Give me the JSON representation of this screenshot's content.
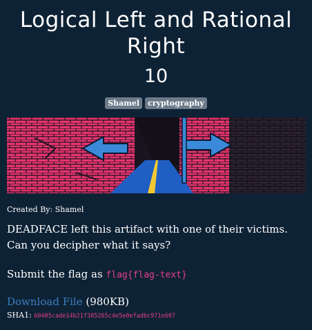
{
  "challenge": {
    "title": "Logical Left and Rational Right",
    "points": "10",
    "tags": [
      "Shamel",
      "cryptography"
    ],
    "created_by": "Created By: Shamel",
    "description": "DEADFACE left this artifact with one of their victims. Can you decipher what it says?",
    "submit_prefix": "Submit the flag as",
    "flag_format": "flag{flag-text}",
    "download_label": "Download File",
    "file_size": "(980KB)",
    "sha_label": "SHA1:",
    "sha_value": "60405cade14b21f385265c4e5e0efadbc971e607"
  },
  "colors": {
    "background": "#0e2235",
    "tag_bg": "#6c7a89",
    "code": "#e83e8c",
    "link": "#3d7fc1",
    "brick": "#e8346e",
    "arrow": "#3b8ad9",
    "road": "#1f5fc4",
    "road_line": "#f2c832"
  }
}
